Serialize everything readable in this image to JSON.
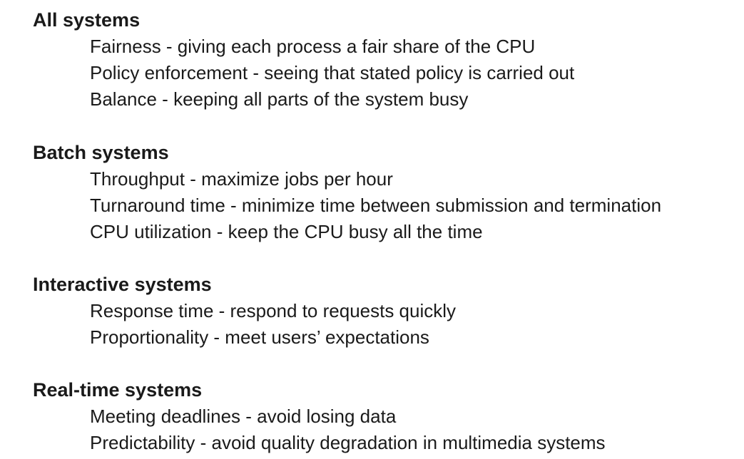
{
  "sections": [
    {
      "heading": "All systems",
      "items": [
        "Fairness - giving each process a fair share of the CPU",
        "Policy enforcement - seeing that stated policy is carried out",
        "Balance - keeping all parts of the system busy"
      ]
    },
    {
      "heading": "Batch systems",
      "items": [
        "Throughput - maximize jobs per hour",
        "Turnaround time - minimize time between submission and termination",
        "CPU utilization - keep the CPU busy all the time"
      ]
    },
    {
      "heading": "Interactive systems",
      "items": [
        "Response time - respond to requests quickly",
        "Proportionality - meet users’ expectations"
      ]
    },
    {
      "heading": "Real-time systems",
      "items": [
        "Meeting deadlines - avoid losing data",
        "Predictability - avoid quality degradation in multimedia systems"
      ]
    }
  ]
}
